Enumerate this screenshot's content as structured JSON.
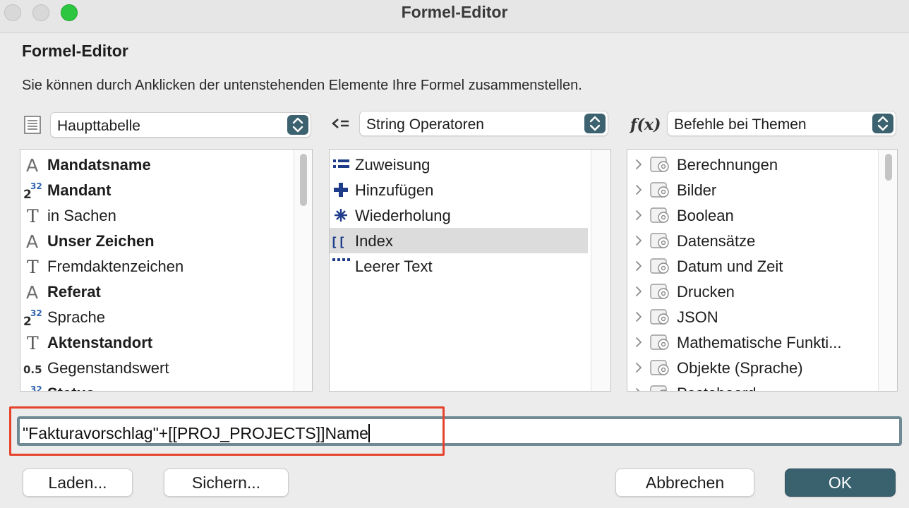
{
  "window": {
    "title": "Formel-Editor"
  },
  "dialog": {
    "title": "Formel-Editor",
    "description": "Sie können durch Anklicken der untenstehenden Elemente Ihre Formel zusammenstellen."
  },
  "tables": {
    "selected": "Haupttabelle",
    "fields": [
      {
        "label": "Mandatsname",
        "bold": true,
        "icon": "alpha-field-icon"
      },
      {
        "label": "Mandant",
        "bold": true,
        "icon": "integer-field-icon"
      },
      {
        "label": "in Sachen",
        "bold": false,
        "icon": "text-field-icon"
      },
      {
        "label": "Unser Zeichen",
        "bold": true,
        "icon": "alpha-field-icon"
      },
      {
        "label": "Fremdaktenzeichen",
        "bold": false,
        "icon": "text-field-icon"
      },
      {
        "label": "Referat",
        "bold": true,
        "icon": "alpha-field-icon"
      },
      {
        "label": "Sprache",
        "bold": false,
        "icon": "integer-field-icon"
      },
      {
        "label": "Aktenstandort",
        "bold": true,
        "icon": "text-field-icon"
      },
      {
        "label": "Gegenstandswert",
        "bold": false,
        "icon": "real-field-icon"
      },
      {
        "label": "Status",
        "bold": true,
        "icon": "integer-field-icon"
      }
    ]
  },
  "operators": {
    "selected": "String Operatoren",
    "items": [
      {
        "label": "Zuweisung",
        "icon": "assignment-icon"
      },
      {
        "label": "Hinzufügen",
        "icon": "plus-icon"
      },
      {
        "label": "Wiederholung",
        "icon": "asterisk-icon"
      },
      {
        "label": "Index",
        "icon": "brackets-icon"
      },
      {
        "label": "Leerer Text",
        "icon": "empty-text-icon"
      }
    ],
    "selected_index": 3
  },
  "commands": {
    "selected": "Befehle bei Themen",
    "items": [
      "Berechnungen",
      "Bilder",
      "Boolean",
      "Datensätze",
      "Datum und Zeit",
      "Drucken",
      "JSON",
      "Mathematische Funkti...",
      "Objekte (Sprache)",
      "Pasteboard"
    ]
  },
  "formula": {
    "value": "\"Fakturavorschlag\"+[[PROJ_PROJECTS]]Name"
  },
  "buttons": {
    "load": "Laden...",
    "save": "Sichern...",
    "cancel": "Abbrechen",
    "ok": "OK"
  },
  "colors": {
    "accent": "#3c6270",
    "highlight": "#e5432c",
    "icon_blue": "#1f3c8a"
  }
}
